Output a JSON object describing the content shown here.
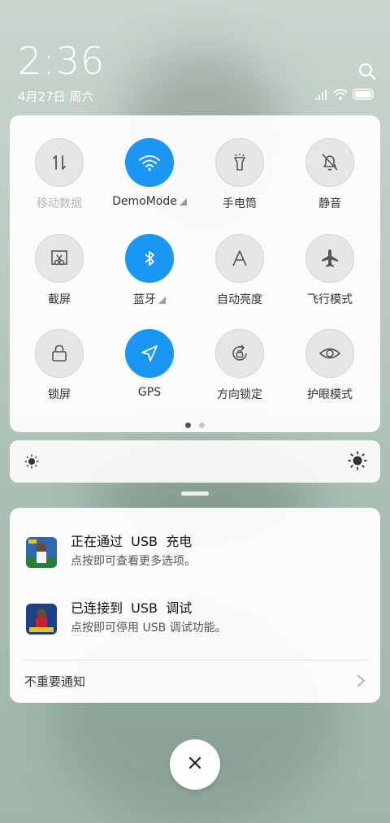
{
  "status": {
    "time": "2:36",
    "date": "4月27日 周六"
  },
  "quick_settings": {
    "tiles": [
      {
        "label": "移动数据",
        "icon": "mobile-data-icon",
        "state": "disabled"
      },
      {
        "label": "DemoMode",
        "icon": "wifi-icon",
        "state": "on",
        "has_more": true
      },
      {
        "label": "手电筒",
        "icon": "flashlight-icon",
        "state": "off"
      },
      {
        "label": "静音",
        "icon": "mute-bell-icon",
        "state": "off"
      },
      {
        "label": "截屏",
        "icon": "screenshot-icon",
        "state": "off"
      },
      {
        "label": "蓝牙",
        "icon": "bluetooth-icon",
        "state": "on",
        "has_more": true
      },
      {
        "label": "自动亮度",
        "icon": "auto-brightness-icon",
        "state": "off"
      },
      {
        "label": "飞行模式",
        "icon": "airplane-icon",
        "state": "off"
      },
      {
        "label": "锁屏",
        "icon": "lock-icon",
        "state": "off"
      },
      {
        "label": "GPS",
        "icon": "location-icon",
        "state": "on"
      },
      {
        "label": "方向锁定",
        "icon": "rotation-lock-icon",
        "state": "off"
      },
      {
        "label": "护眼模式",
        "icon": "eye-icon",
        "state": "off"
      }
    ],
    "page_count": 2,
    "current_page": 1
  },
  "notifications": [
    {
      "title": "正在通过  USB  充电",
      "body": "点按即可查看更多选项。"
    },
    {
      "title": "已连接到  USB  调试",
      "body": "点按即可停用 USB 调试功能。"
    }
  ],
  "unimportant_label": "不重要通知",
  "colors": {
    "accent": "#1a96f5",
    "tile_off": "#e6e6e6"
  }
}
